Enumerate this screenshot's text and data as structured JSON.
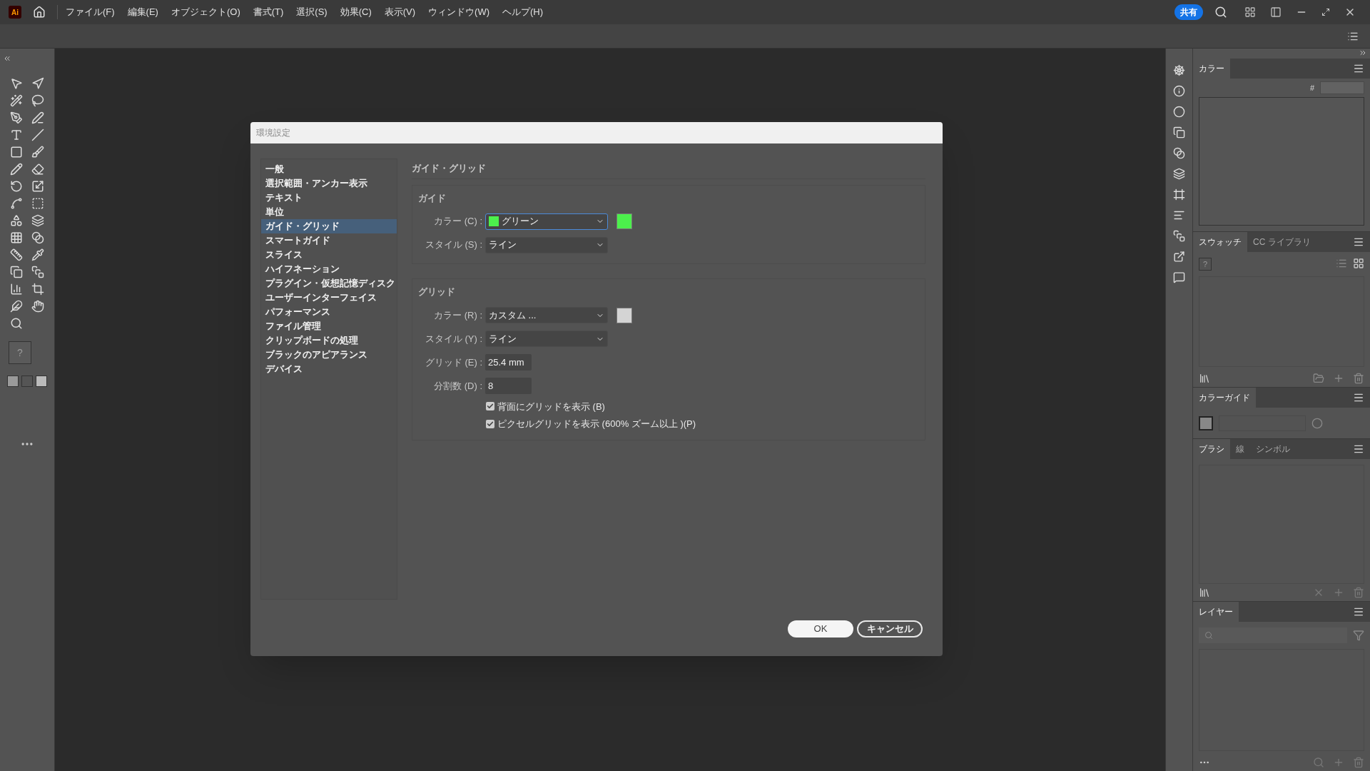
{
  "app": {
    "logo": "Ai"
  },
  "menu": [
    "ファイル(F)",
    "編集(E)",
    "オブジェクト(O)",
    "書式(T)",
    "選択(S)",
    "効果(C)",
    "表示(V)",
    "ウィンドウ(W)",
    "ヘルプ(H)"
  ],
  "share_button": "共有",
  "toolbar": {
    "fill_mark": "?"
  },
  "dialog": {
    "title": "環境設定",
    "categories": [
      {
        "label": "一般",
        "selected": false
      },
      {
        "label": "選択範囲・アンカー表示",
        "selected": false
      },
      {
        "label": "テキスト",
        "selected": false
      },
      {
        "label": "単位",
        "selected": false
      },
      {
        "label": "ガイド・グリッド",
        "selected": true
      },
      {
        "label": "スマートガイド",
        "selected": false
      },
      {
        "label": "スライス",
        "selected": false
      },
      {
        "label": "ハイフネーション",
        "selected": false
      },
      {
        "label": "プラグイン・仮想記憶ディスク",
        "selected": false
      },
      {
        "label": "ユーザーインターフェイス",
        "selected": false
      },
      {
        "label": "パフォーマンス",
        "selected": false
      },
      {
        "label": "ファイル管理",
        "selected": false
      },
      {
        "label": "クリップボードの処理",
        "selected": false
      },
      {
        "label": "ブラックのアピアランス",
        "selected": false
      },
      {
        "label": "デバイス",
        "selected": false
      }
    ],
    "section_title": "ガイド・グリッド",
    "groups": [
      {
        "heading": "ガイド",
        "rows": [
          {
            "kind": "select",
            "label": "カラー (C) :",
            "value": "グリーン",
            "color": "#4cf04c",
            "focused": true
          },
          {
            "kind": "select",
            "label": "スタイル (S) :",
            "value": "ライン",
            "focused": false
          }
        ]
      },
      {
        "heading": "グリッド",
        "rows": [
          {
            "kind": "select",
            "label": "カラー (R) :",
            "value": "カスタム ...",
            "color": "#d4d4d4",
            "focused": false
          },
          {
            "kind": "select",
            "label": "スタイル (Y) :",
            "value": "ライン",
            "focused": false
          },
          {
            "kind": "input",
            "label": "グリッド (E) :",
            "value": "25.4 mm"
          },
          {
            "kind": "input",
            "label": "分割数 (D) :",
            "value": "8"
          },
          {
            "kind": "checkbox",
            "label": "背面にグリッドを表示 (B)",
            "checked": true
          },
          {
            "kind": "checkbox",
            "label": "ピクセルグリッドを表示 (600% ズーム以上 )(P)",
            "checked": true
          }
        ]
      }
    ],
    "buttons": [
      {
        "label": "OK",
        "default": true
      },
      {
        "label": "キャンセル",
        "default": false
      }
    ]
  },
  "panels": {
    "color": {
      "tab": "カラー",
      "hex_label": "#"
    },
    "swatches": {
      "tabs": [
        {
          "label": "スウォッチ",
          "selected": true
        },
        {
          "label": "CC ライブラリ",
          "selected": false
        }
      ],
      "mark": "?"
    },
    "color_guide": {
      "tab": "カラーガイド"
    },
    "brushes": {
      "tabs": [
        {
          "label": "ブラシ",
          "selected": true
        },
        {
          "label": "線",
          "selected": false
        },
        {
          "label": "シンボル",
          "selected": false
        }
      ]
    },
    "layers": {
      "tab": "レイヤー"
    }
  }
}
